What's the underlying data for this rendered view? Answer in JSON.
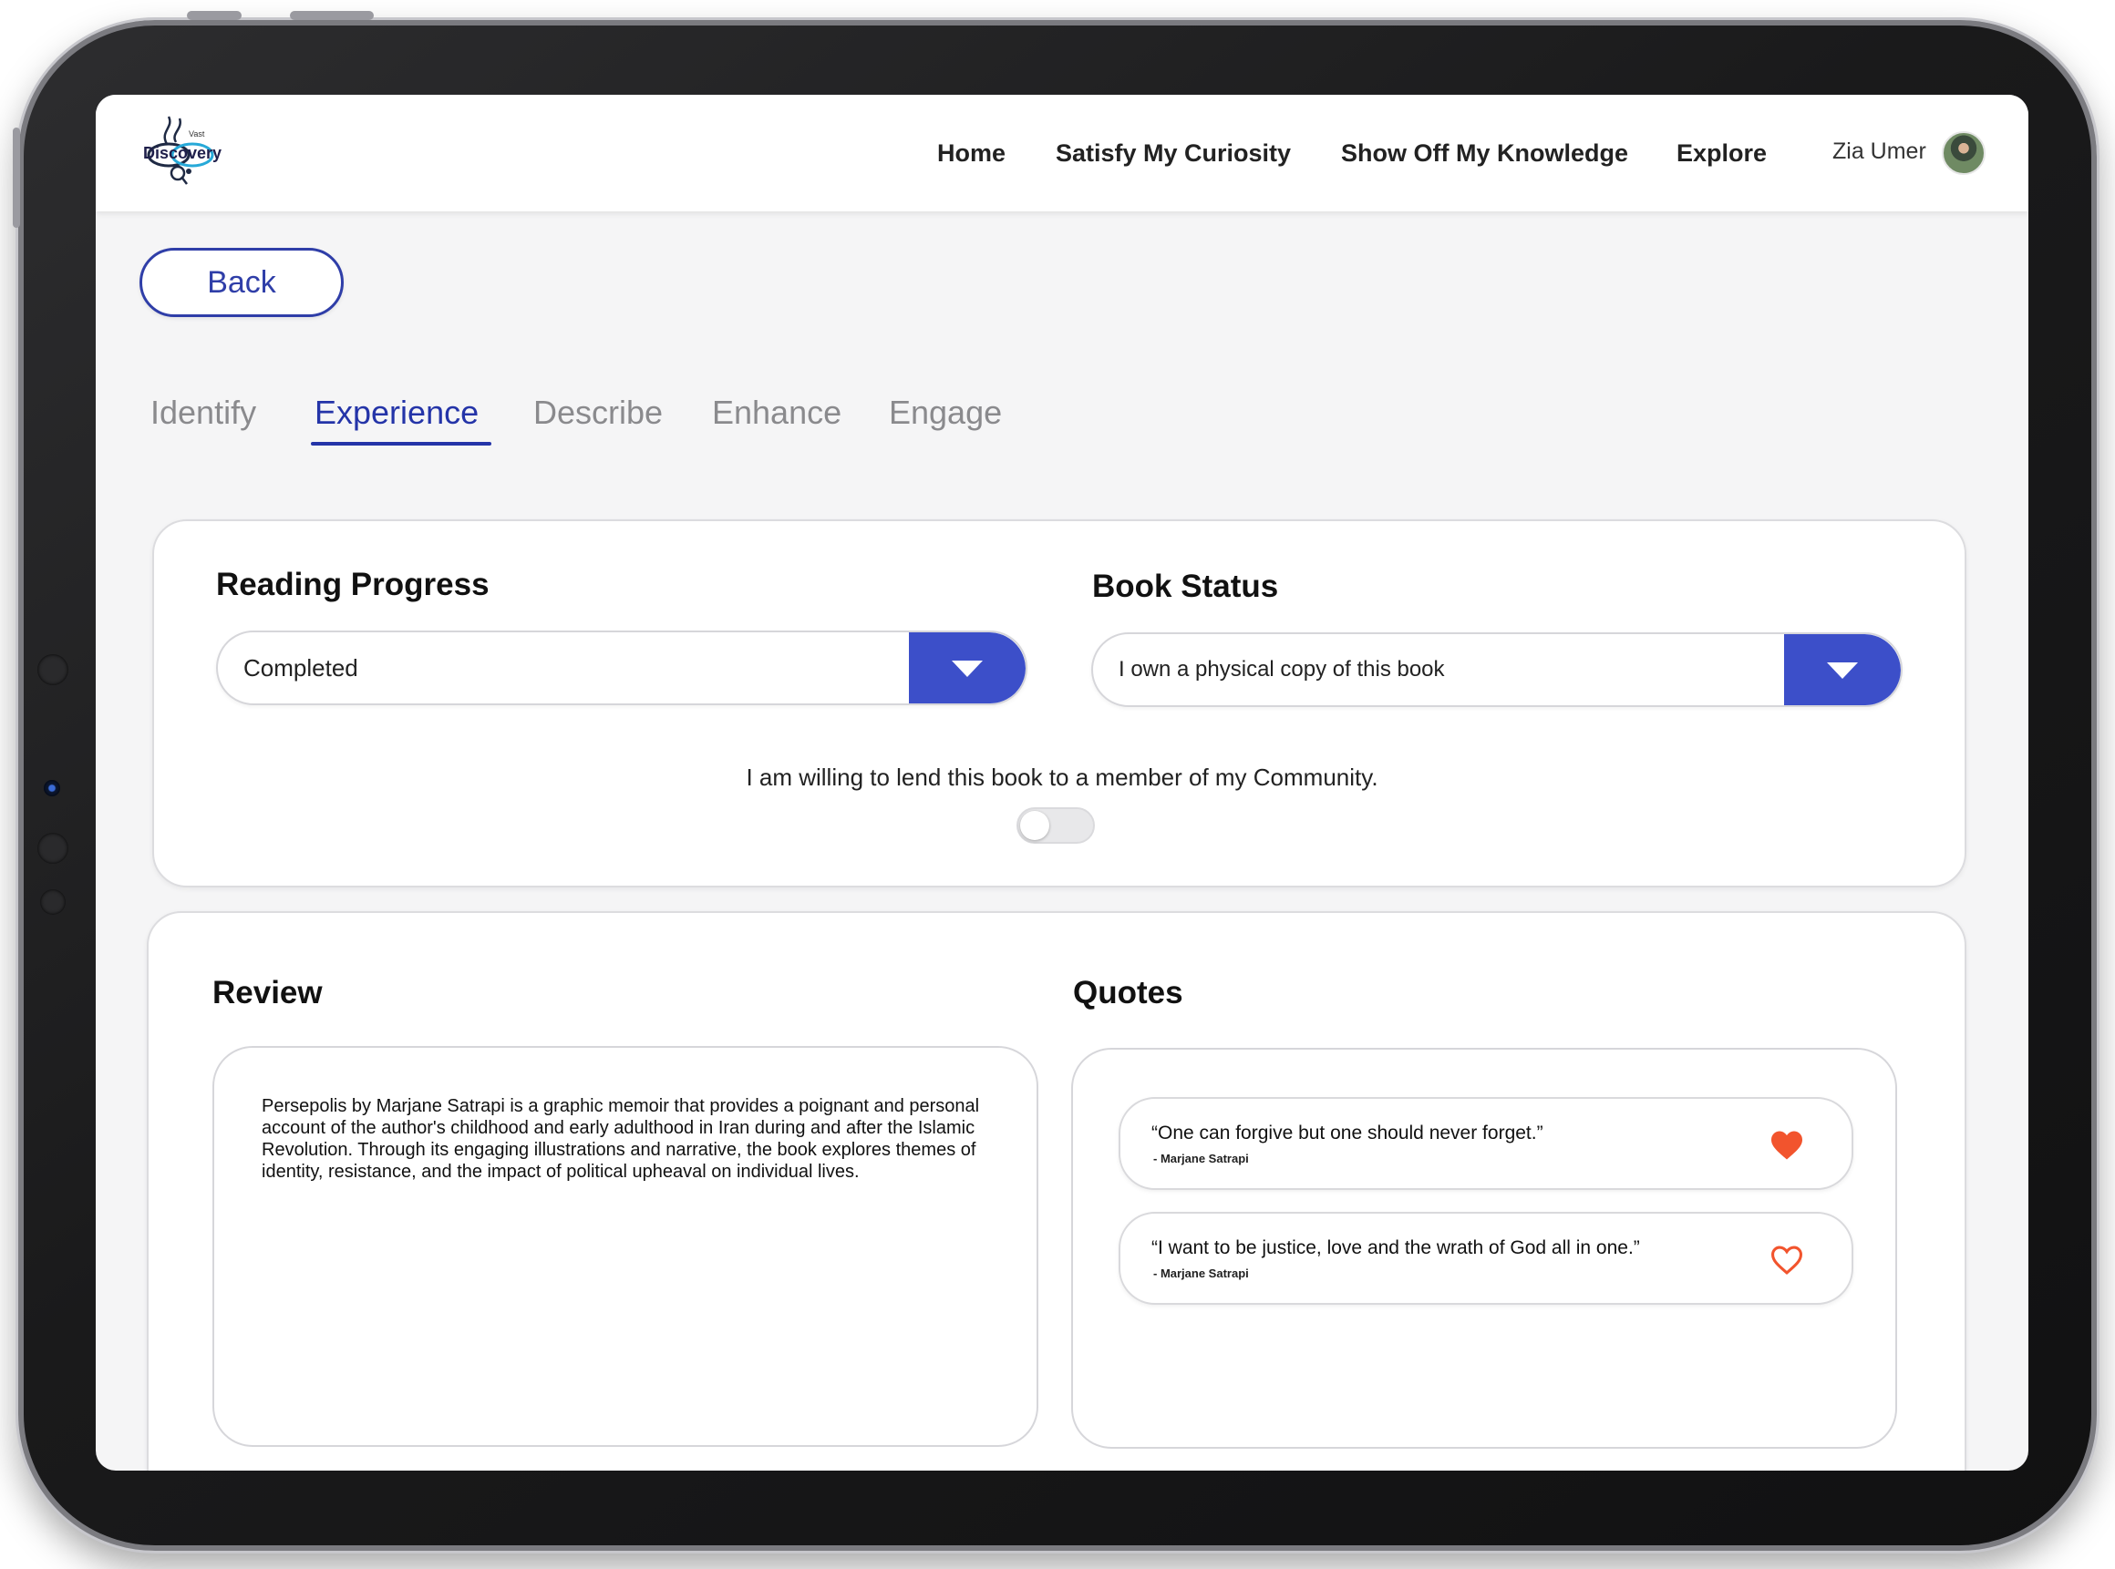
{
  "header": {
    "logo_text": "Discovery",
    "logo_small": "Vast",
    "nav": [
      "Home",
      "Satisfy My Curiosity",
      "Show Off My Knowledge",
      "Explore"
    ],
    "user_name": "Zia Umer"
  },
  "back_label": "Back",
  "tabs": [
    {
      "label": "Identify",
      "active": false
    },
    {
      "label": "Experience",
      "active": true
    },
    {
      "label": "Describe",
      "active": false
    },
    {
      "label": "Enhance",
      "active": false
    },
    {
      "label": "Engage",
      "active": false
    }
  ],
  "reading_progress": {
    "title": "Reading Progress",
    "value": "Completed"
  },
  "book_status": {
    "title": "Book Status",
    "value": "I own a physical copy of this book"
  },
  "lend": {
    "text": "I am willing to lend this book to a member of my Community.",
    "enabled": false
  },
  "review": {
    "title": "Review",
    "text": "Persepolis by Marjane Satrapi is a graphic memoir that provides a poignant and personal account of the author's childhood and early adulthood in Iran during and after the Islamic Revolution. Through its engaging illustrations and narrative, the book explores themes of identity, resistance, and the impact of political upheaval on individual lives."
  },
  "quotes": {
    "title": "Quotes",
    "items": [
      {
        "text": "“One can forgive but one should never forget.”",
        "author": "- Marjane Satrapi",
        "liked": true
      },
      {
        "text": "“I want to be justice, love and the wrath of God all in one.”",
        "author": "- Marjane Satrapi",
        "liked": false
      }
    ]
  },
  "colors": {
    "accent": "#2434a8",
    "dropdown": "#3c4fc9",
    "heart": "#f2542d"
  }
}
